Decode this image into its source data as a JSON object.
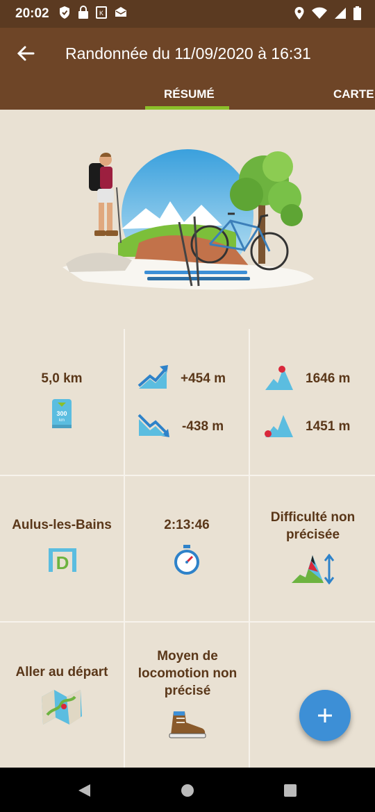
{
  "status_bar": {
    "time": "20:02",
    "left_icons": [
      "shield-icon",
      "lock-icon",
      "k-icon",
      "mail-icon"
    ],
    "right_icons": [
      "location-icon",
      "wifi-icon",
      "signal-icon",
      "battery-icon"
    ]
  },
  "header": {
    "title": "Randonnée du 11/09/2020 à 16:31",
    "tabs": [
      {
        "label": "RÉSUMÉ",
        "active": true
      },
      {
        "label": "CARTE",
        "active": false
      }
    ]
  },
  "colors": {
    "status_bar": "#5b3a21",
    "app_bar": "#6e4527",
    "tab_indicator": "#8bbf2a",
    "background": "#e9e1d3",
    "text": "#5a3719",
    "fab": "#3d8fd6",
    "icon_blue": "#5bbde0"
  },
  "stats": {
    "distance": "5,0 km",
    "ascent": "+454 m",
    "descent": "-438 m",
    "max_altitude": "1646 m",
    "min_altitude": "1451 m",
    "start_place": "Aulus-les-Bains",
    "duration": "2:13:46",
    "difficulty": "Difficulté non précisée",
    "go_to_start": "Aller au départ",
    "locomotion": "Moyen de locomotion non précisé"
  },
  "icons": {
    "distance": "distance-marker-icon",
    "distance_marker_text": [
      "300",
      "km"
    ],
    "ascent": "ascent-trend-icon",
    "descent": "descent-trend-icon",
    "max_alt": "peak-max-icon",
    "min_alt": "peak-min-icon",
    "start": "start-d-icon",
    "start_letter": "D",
    "duration": "stopwatch-icon",
    "difficulty": "difficulty-icon",
    "map": "map-icon",
    "locomotion": "hiking-boot-icon"
  },
  "fab": {
    "icon": "plus-icon",
    "label": "+"
  }
}
